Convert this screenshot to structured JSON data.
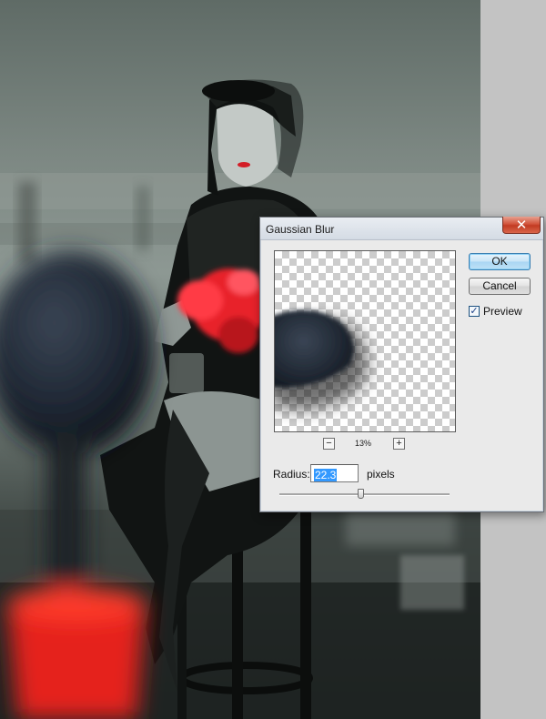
{
  "dialog": {
    "title": "Gaussian Blur",
    "close_glyph": "✕",
    "ok_label": "OK",
    "cancel_label": "Cancel",
    "preview_label": "Preview",
    "preview_checked": true,
    "check_glyph": "✓",
    "zoom": {
      "minus": "−",
      "plus": "+",
      "level": "13%"
    },
    "radius": {
      "label": "Radius:",
      "value": "22.3",
      "unit": "pixels",
      "slider_fraction": 0.48
    }
  },
  "icons": {
    "close": "close-icon",
    "zoom_out": "minus-icon",
    "zoom_in": "plus-icon",
    "check": "checkmark-icon"
  },
  "colors": {
    "close_button": "#c23b22",
    "default_button_border": "#3c7fb1",
    "selection_highlight": "#3399ff",
    "rose_red": "#e8202a"
  }
}
